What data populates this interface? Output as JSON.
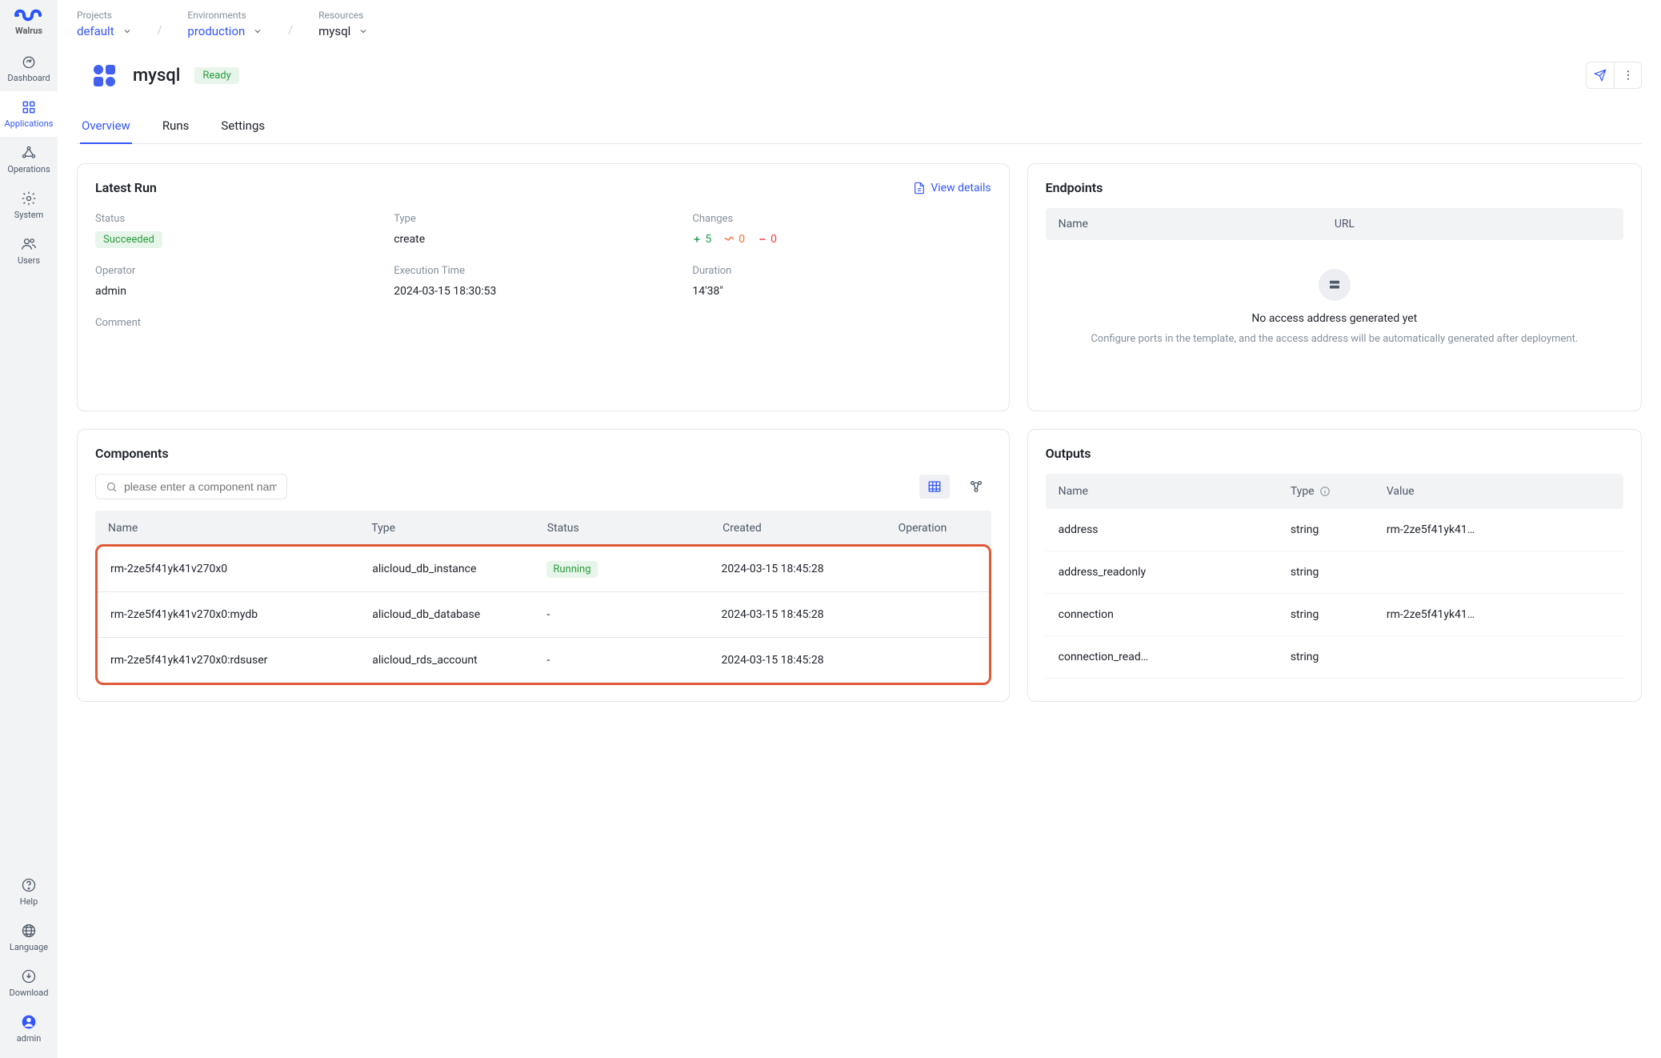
{
  "brand": "Walrus",
  "sidebar": {
    "top": [
      {
        "label": "Dashboard"
      },
      {
        "label": "Applications"
      },
      {
        "label": "Operations"
      },
      {
        "label": "System"
      },
      {
        "label": "Users"
      }
    ],
    "bottom": [
      {
        "label": "Help"
      },
      {
        "label": "Language"
      },
      {
        "label": "Download"
      },
      {
        "label": "admin"
      }
    ]
  },
  "breadcrumb": {
    "projects_label": "Projects",
    "projects_value": "default",
    "env_label": "Environments",
    "env_value": "production",
    "res_label": "Resources",
    "res_value": "mysql"
  },
  "resource": {
    "title": "mysql",
    "status": "Ready"
  },
  "tabs": [
    "Overview",
    "Runs",
    "Settings"
  ],
  "latest_run": {
    "title": "Latest Run",
    "view_details": "View details",
    "labels": {
      "status": "Status",
      "type": "Type",
      "changes": "Changes",
      "operator": "Operator",
      "exec_time": "Execution Time",
      "duration": "Duration",
      "comment": "Comment"
    },
    "status": "Succeeded",
    "type": "create",
    "changes": {
      "add": 5,
      "mod": 0,
      "del": 0
    },
    "operator": "admin",
    "exec_time": "2024-03-15 18:30:53",
    "duration": "14'38\""
  },
  "endpoints": {
    "title": "Endpoints",
    "columns": {
      "name": "Name",
      "url": "URL"
    },
    "empty_title": "No access address generated yet",
    "empty_sub": "Configure ports in the template, and the access address will be automatically generated after deployment."
  },
  "components": {
    "title": "Components",
    "search_placeholder": "please enter a component name",
    "columns": {
      "name": "Name",
      "type": "Type",
      "status": "Status",
      "created": "Created",
      "operation": "Operation"
    },
    "rows": [
      {
        "name": "rm-2ze5f41yk41v270x0",
        "type": "alicloud_db_instance",
        "status": "Running",
        "created": "2024-03-15 18:45:28"
      },
      {
        "name": "rm-2ze5f41yk41v270x0:mydb",
        "type": "alicloud_db_database",
        "status": "-",
        "created": "2024-03-15 18:45:28"
      },
      {
        "name": "rm-2ze5f41yk41v270x0:rdsuser",
        "type": "alicloud_rds_account",
        "status": "-",
        "created": "2024-03-15 18:45:28"
      }
    ]
  },
  "outputs": {
    "title": "Outputs",
    "columns": {
      "name": "Name",
      "type": "Type",
      "value": "Value"
    },
    "rows": [
      {
        "name": "address",
        "type": "string",
        "value": "rm-2ze5f41yk41…"
      },
      {
        "name": "address_readonly",
        "type": "string",
        "value": ""
      },
      {
        "name": "connection",
        "type": "string",
        "value": "rm-2ze5f41yk41…"
      },
      {
        "name": "connection_read…",
        "type": "string",
        "value": ""
      }
    ]
  }
}
